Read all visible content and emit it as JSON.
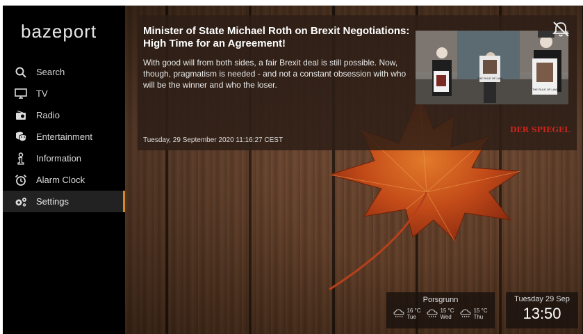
{
  "app": {
    "logo": "bazeport"
  },
  "sidebar": {
    "items": [
      {
        "label": "Search",
        "icon": "search-icon"
      },
      {
        "label": "TV",
        "icon": "tv-icon"
      },
      {
        "label": "Radio",
        "icon": "radio-icon"
      },
      {
        "label": "Entertainment",
        "icon": "entertainment-icon"
      },
      {
        "label": "Information",
        "icon": "information-icon"
      },
      {
        "label": "Alarm Clock",
        "icon": "alarm-clock-icon"
      },
      {
        "label": "Settings",
        "icon": "settings-icon",
        "active": true
      }
    ]
  },
  "news": {
    "title": "Minister of State Michael Roth on Brexit Negotiations: High Time for an Agreement!",
    "body": "With good will from both sides, a fair Brexit deal is still possible. Now, though, pragmatism is needed - and not a constant obsession with who will be the winner and who the loser.",
    "date": "Tuesday, 29 September 2020 11:16:27 CEST",
    "source": "DER SPIEGEL",
    "photo_sign_1": "THE RULE OF LAW",
    "photo_sign_2": "THE RULE OF LAW"
  },
  "weather": {
    "city": "Porsgrunn",
    "days": [
      {
        "temp": "16 °C",
        "day": "Tue",
        "icon": "cloud-rain-icon"
      },
      {
        "temp": "15 °C",
        "day": "Wed",
        "icon": "cloud-rain-icon"
      },
      {
        "temp": "15 °C",
        "day": "Thu",
        "icon": "cloud-rain-icon"
      }
    ]
  },
  "clock": {
    "date": "Tuesday 29 Sep",
    "time": "13:50"
  },
  "colors": {
    "accent": "#d48a2a",
    "source_red": "#c8261e"
  }
}
